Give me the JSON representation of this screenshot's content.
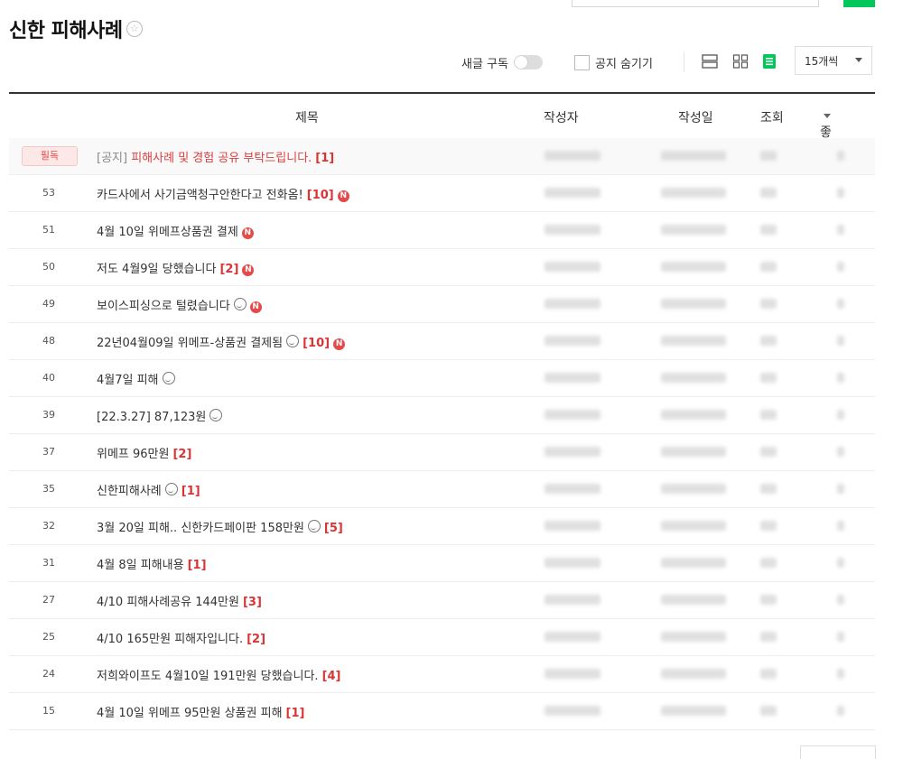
{
  "page_title": "신한 피해사례",
  "star_icon": "☆",
  "controls": {
    "subscribe_label": "새글 구독",
    "hide_notice_label": "공지 숨기기",
    "page_size": "15개씩"
  },
  "header": {
    "title": "제목",
    "author": "작성자",
    "date": "작성일",
    "views": "조회",
    "likes": "좋아요"
  },
  "notice": {
    "badge": "필독",
    "prefix": "[공지]",
    "subject": "피해사례 및 경험 공유 부탁드립니다.",
    "comments": "[1]"
  },
  "rows": [
    {
      "num": "53",
      "subject": "카드사에서 사기금액청구안한다고 전화옴!",
      "comments": "[10]",
      "emoji": false,
      "new": true
    },
    {
      "num": "51",
      "subject": "4월 10일 위메프상품권 결제",
      "comments": "",
      "emoji": false,
      "new": true
    },
    {
      "num": "50",
      "subject": "저도 4월9일 당했습니다",
      "comments": "[2]",
      "emoji": false,
      "new": true
    },
    {
      "num": "49",
      "subject": "보이스피싱으로 털렸습니다",
      "comments": "",
      "emoji": true,
      "new": true
    },
    {
      "num": "48",
      "subject": "22년04월09일 위메프-상품권 결제됨",
      "comments": "[10]",
      "emoji": true,
      "new": true
    },
    {
      "num": "40",
      "subject": "4월7일 피해",
      "comments": "",
      "emoji": true,
      "new": false
    },
    {
      "num": "39",
      "subject": "[22.3.27] 87,123원",
      "comments": "",
      "emoji": true,
      "new": false
    },
    {
      "num": "37",
      "subject": "위메프 96만원",
      "comments": "[2]",
      "emoji": false,
      "new": false
    },
    {
      "num": "35",
      "subject": "신한피해사례",
      "comments": "[1]",
      "emoji": true,
      "new": false
    },
    {
      "num": "32",
      "subject": "3월 20일 피해.. 신한카드페이판 158만원",
      "comments": "[5]",
      "emoji": true,
      "new": false
    },
    {
      "num": "31",
      "subject": "4월 8일 피해내용",
      "comments": "[1]",
      "emoji": false,
      "new": false
    },
    {
      "num": "27",
      "subject": "4/10 피해사례공유 144만원",
      "comments": "[3]",
      "emoji": false,
      "new": false
    },
    {
      "num": "25",
      "subject": "4/10 165만원 피해자입니다.",
      "comments": "[2]",
      "emoji": false,
      "new": false
    },
    {
      "num": "24",
      "subject": "저희와이프도 4월10일 191만원 당했습니다.",
      "comments": "[4]",
      "emoji": false,
      "new": false
    },
    {
      "num": "15",
      "subject": "4월 10일 위메프 95만원 상품권 피해",
      "comments": "[1]",
      "emoji": false,
      "new": false
    }
  ],
  "new_badge": "N",
  "accent_color": "#03c75a",
  "comment_color": "#d93535"
}
